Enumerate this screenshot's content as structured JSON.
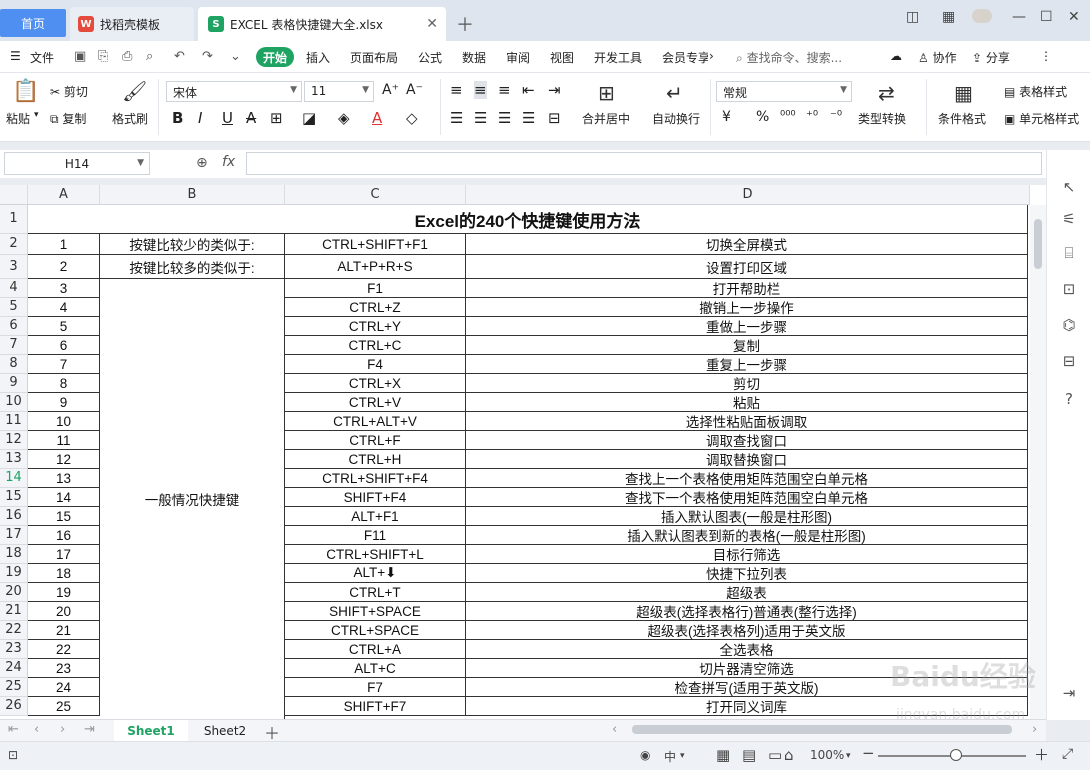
{
  "tabs": {
    "home": "首页",
    "template": "找稻壳模板",
    "file": "EXCEL 表格快捷键大全.xlsx",
    "file_icon": "S",
    "template_icon": "W"
  },
  "menu": {
    "file": "文件",
    "start": "开始",
    "items": [
      "插入",
      "页面布局",
      "公式",
      "数据",
      "审阅",
      "视图",
      "开发工具",
      "会员专享"
    ],
    "search": "查找命令、搜索...",
    "collab": "协作",
    "share": "分享"
  },
  "ribbon": {
    "paste": "粘贴",
    "cut": "剪切",
    "copy": "复制",
    "format_painter": "格式刷",
    "font_name": "宋体",
    "font_size": "11",
    "merge_center": "合并居中",
    "wrap_text": "自动换行",
    "number_format": "常规",
    "type_convert": "类型转换",
    "cond_format": "条件格式",
    "table_style": "表格样式",
    "cell_style": "单元格样式",
    "currency": "¥",
    "percent": "%"
  },
  "formula_bar": {
    "cell_ref": "H14",
    "fx": "fx",
    "value": ""
  },
  "columns": [
    "A",
    "B",
    "C",
    "D"
  ],
  "sheet": {
    "title": "Excel的240个快捷键使用方法",
    "category_1": "按键比较少的类似于:",
    "category_2": "按键比较多的类似于:",
    "category_general": "一般情况快捷键",
    "rows": [
      {
        "n": "1",
        "key": "CTRL+SHIFT+F1",
        "desc": "切换全屏模式"
      },
      {
        "n": "2",
        "key": "ALT+P+R+S",
        "desc": "设置打印区域"
      },
      {
        "n": "3",
        "key": "F1",
        "desc": "打开帮助栏"
      },
      {
        "n": "4",
        "key": "CTRL+Z",
        "desc": "撤销上一步操作"
      },
      {
        "n": "5",
        "key": "CTRL+Y",
        "desc": "重做上一步骤"
      },
      {
        "n": "6",
        "key": "CTRL+C",
        "desc": "复制"
      },
      {
        "n": "7",
        "key": "F4",
        "desc": "重复上一步骤"
      },
      {
        "n": "8",
        "key": "CTRL+X",
        "desc": "剪切"
      },
      {
        "n": "9",
        "key": "CTRL+V",
        "desc": "粘贴"
      },
      {
        "n": "10",
        "key": "CTRL+ALT+V",
        "desc": "选择性粘贴面板调取"
      },
      {
        "n": "11",
        "key": "CTRL+F",
        "desc": "调取查找窗口"
      },
      {
        "n": "12",
        "key": "CTRL+H",
        "desc": "调取替换窗口"
      },
      {
        "n": "13",
        "key": "CTRL+SHIFT+F4",
        "desc": "查找上一个表格使用矩阵范围空白单元格"
      },
      {
        "n": "14",
        "key": "SHIFT+F4",
        "desc": "查找下一个表格使用矩阵范围空白单元格"
      },
      {
        "n": "15",
        "key": "ALT+F1",
        "desc": "插入默认图表(一般是柱形图)"
      },
      {
        "n": "16",
        "key": "F11",
        "desc": "插入默认图表到新的表格(一般是柱形图)"
      },
      {
        "n": "17",
        "key": "CTRL+SHIFT+L",
        "desc": "目标行筛选"
      },
      {
        "n": "18",
        "key": "ALT+⬇",
        "desc": "快捷下拉列表"
      },
      {
        "n": "19",
        "key": "CTRL+T",
        "desc": "超级表"
      },
      {
        "n": "20",
        "key": "SHIFT+SPACE",
        "desc": "超级表(选择表格行)普通表(整行选择)"
      },
      {
        "n": "21",
        "key": "CTRL+SPACE",
        "desc": "超级表(选择表格列)适用于英文版"
      },
      {
        "n": "22",
        "key": "CTRL+A",
        "desc": "全选表格"
      },
      {
        "n": "23",
        "key": "ALT+C",
        "desc": "切片器清空筛选"
      },
      {
        "n": "24",
        "key": "F7",
        "desc": "检查拼写(适用于英文版)"
      },
      {
        "n": "25",
        "key": "SHIFT+F7",
        "desc": "打开同义词库"
      }
    ]
  },
  "row_numbers": [
    "1",
    "2",
    "3",
    "4",
    "5",
    "6",
    "7",
    "8",
    "9",
    "10",
    "11",
    "12",
    "13",
    "14",
    "15",
    "16",
    "17",
    "18",
    "19",
    "20",
    "21",
    "22",
    "23",
    "24",
    "25",
    "26"
  ],
  "sheet_tabs": [
    "Sheet1",
    "Sheet2"
  ],
  "status": {
    "zoom": "100%",
    "lang": "中"
  },
  "watermark": {
    "text": "Baidu经验",
    "sub": "jingyan.baidu.com"
  },
  "colors": {
    "accent_green": "#1fa363",
    "home_tab": "#4f8ff1"
  }
}
